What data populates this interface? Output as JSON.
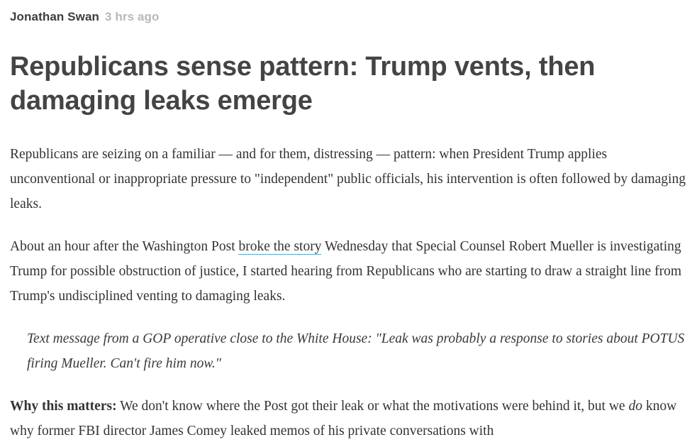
{
  "byline": {
    "author": "Jonathan Swan",
    "time": "3 hrs ago"
  },
  "headline": "Republicans sense pattern: Trump vents, then damaging leaks emerge",
  "paragraphs": {
    "p1": "Republicans are seizing on a familiar — and for them, distressing — pattern: when President Trump applies unconventional or inappropriate pressure to \"independent\" public officials, his intervention is often followed by damaging leaks.",
    "p2_before": "About an hour after the Washington Post ",
    "p2_link": "broke the story",
    "p2_after": " Wednesday that Special Counsel Robert Mueller is investigating Trump for possible obstruction of justice, I started hearing from Republicans who are starting to draw a straight line from Trump's undisciplined venting to damaging leaks.",
    "quote": "Text message from a GOP operative close to the White House: \"Leak was probably a response to stories about POTUS firing Mueller. Can't fire him now.\"",
    "p4_lead": "Why this matters:",
    "p4_before": " We don't know where the Post got their leak or what the motivations were behind it, but we ",
    "p4_em": "do",
    "p4_after": " know why former FBI director James Comey leaked memos of his private conversations with"
  },
  "colors": {
    "link_underline": "#5aa5c8",
    "timestamp": "#b8b8b8",
    "headline": "#444444"
  }
}
